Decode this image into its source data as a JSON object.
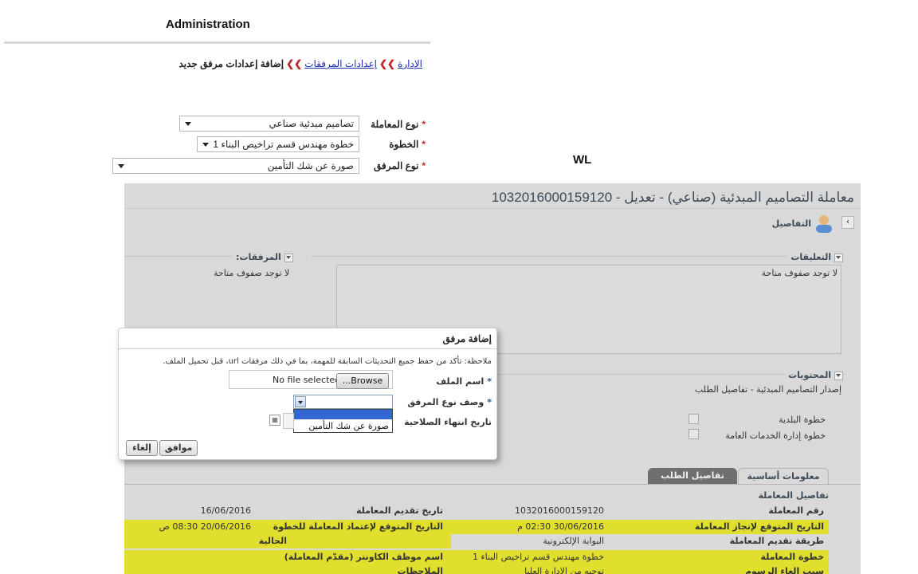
{
  "captions": {
    "admin": "Administration",
    "wl": "WL"
  },
  "admin": {
    "breadcrumb": {
      "item1": "الإدارة",
      "item2": "إعدادات المرفقات",
      "current": "إضافة إعدادات مرفق جديد",
      "separator": "❯❯"
    },
    "fields": [
      {
        "label": "نوع المعاملة",
        "required_mark": "*",
        "value": "تصاميم مبدئية صناعي"
      },
      {
        "label": "الخطوة",
        "required_mark": "*",
        "value": "خطوة مهندس قسم تراخيص البناء 1"
      },
      {
        "label": "نوع المرفق",
        "required_mark": "*",
        "value": "صورة عن شك التأمين"
      }
    ]
  },
  "wl": {
    "title": "معاملة التصاميم المبدئية (صناعي) - تعديل - 1032016000159120",
    "details_label": "التفاصيل",
    "back_icon": "chevron-left-icon",
    "comments": {
      "title": "التعليقات",
      "empty": "لا توجد صفوف متاحة"
    },
    "attachments": {
      "title": "المرفقات:",
      "empty": "لا توجد صفوف متاحة"
    },
    "contents": {
      "title": "المحتويات",
      "subtitle": "إصدار التصاميم المبدئية - تفاصيل الطلب",
      "items": [
        "خطوة البلدية",
        "خطوة إدارة الخدمات العامة"
      ]
    },
    "tabs": [
      "معلومات أساسية",
      "تفاصيل الطلب"
    ],
    "transaction": {
      "section_title": "تفاصيل المعاملة",
      "rows": [
        {
          "l1": "رقم المعاملة",
          "v1": "1032016000159120",
          "l2": "تاريخ تقديم المعاملة",
          "v2": "16/06/2016",
          "highlight": false
        },
        {
          "l1": "التاريخ المتوقع لإنجاز المعاملة",
          "v1": "30/06/2016 02:30 م",
          "l2": "التاريخ المتوقع لإعتماد المعاملة للخطوة",
          "v2": "20/06/2016 08:30 ص",
          "highlight": true
        },
        {
          "l1": "طريقة تقديم المعاملة",
          "v1": "البوابة الإلكترونية",
          "l2": "الحالية",
          "v2": "",
          "highlight": true
        },
        {
          "l1": "خطوة المعاملة",
          "v1": "خطوة مهندس قسم تراخيص البناء 1",
          "l2": "اسم موظف الكاونتر (مقدّم المعاملة)",
          "v2": "",
          "highlight": false
        },
        {
          "l1": "سبب إلغاء الرسوم",
          "v1": "توجيه من الإدارة العليا",
          "l2": "الملاحظات",
          "v2": "",
          "highlight": true
        }
      ]
    }
  },
  "dialog": {
    "title": "إضافة مرفق",
    "note": "ملاحظة: تأكد من حفظ جميع التحديثات السابقة للمهمة، بما في ذلك مرفقات url، قبل تحميل الملف.",
    "file_label": "اسم الملف",
    "required_mark": "*",
    "no_file": "No file selected.",
    "browse": "...Browse",
    "type_label": "وصف نوع المرفق",
    "type_option": "صورة عن شك التأمين",
    "expiry_label": "تاريخ انتهاء الصلاحية",
    "ok": "موافق",
    "cancel": "إلغاء"
  }
}
